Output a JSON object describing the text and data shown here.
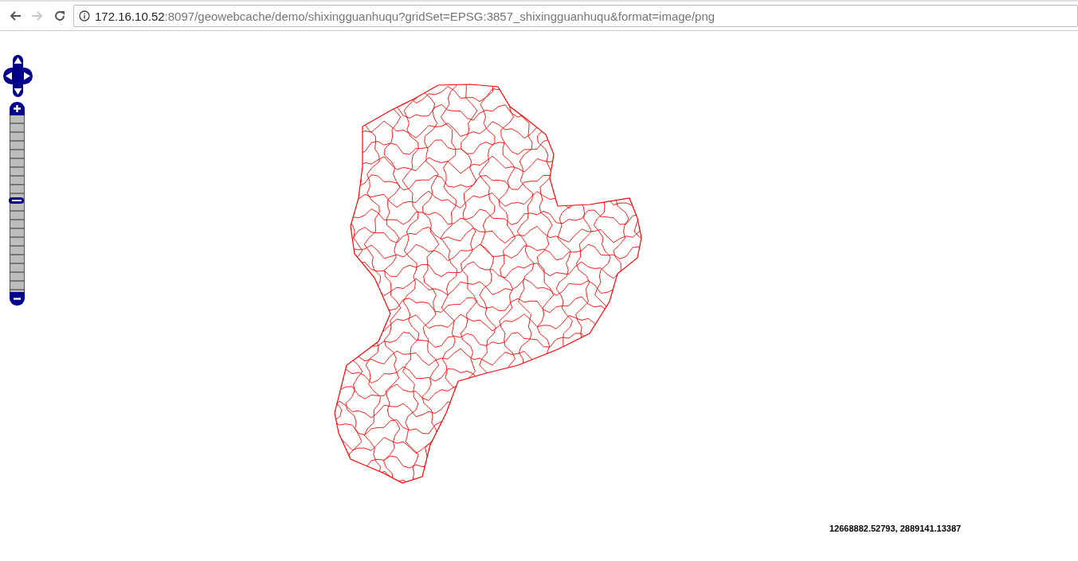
{
  "toolbar": {
    "back": {
      "disabled": false
    },
    "forward": {
      "disabled": true
    }
  },
  "address_bar": {
    "host": "172.16.10.52",
    "rest": ":8097/geowebcache/demo/shixingguanhuqu?gridSet=EPSG:3857_shixingguanhuqu&format=image/png"
  },
  "zoom_slider": {
    "level": 0.52
  },
  "mouse_position": "12668882.52793, 2889141.13387"
}
